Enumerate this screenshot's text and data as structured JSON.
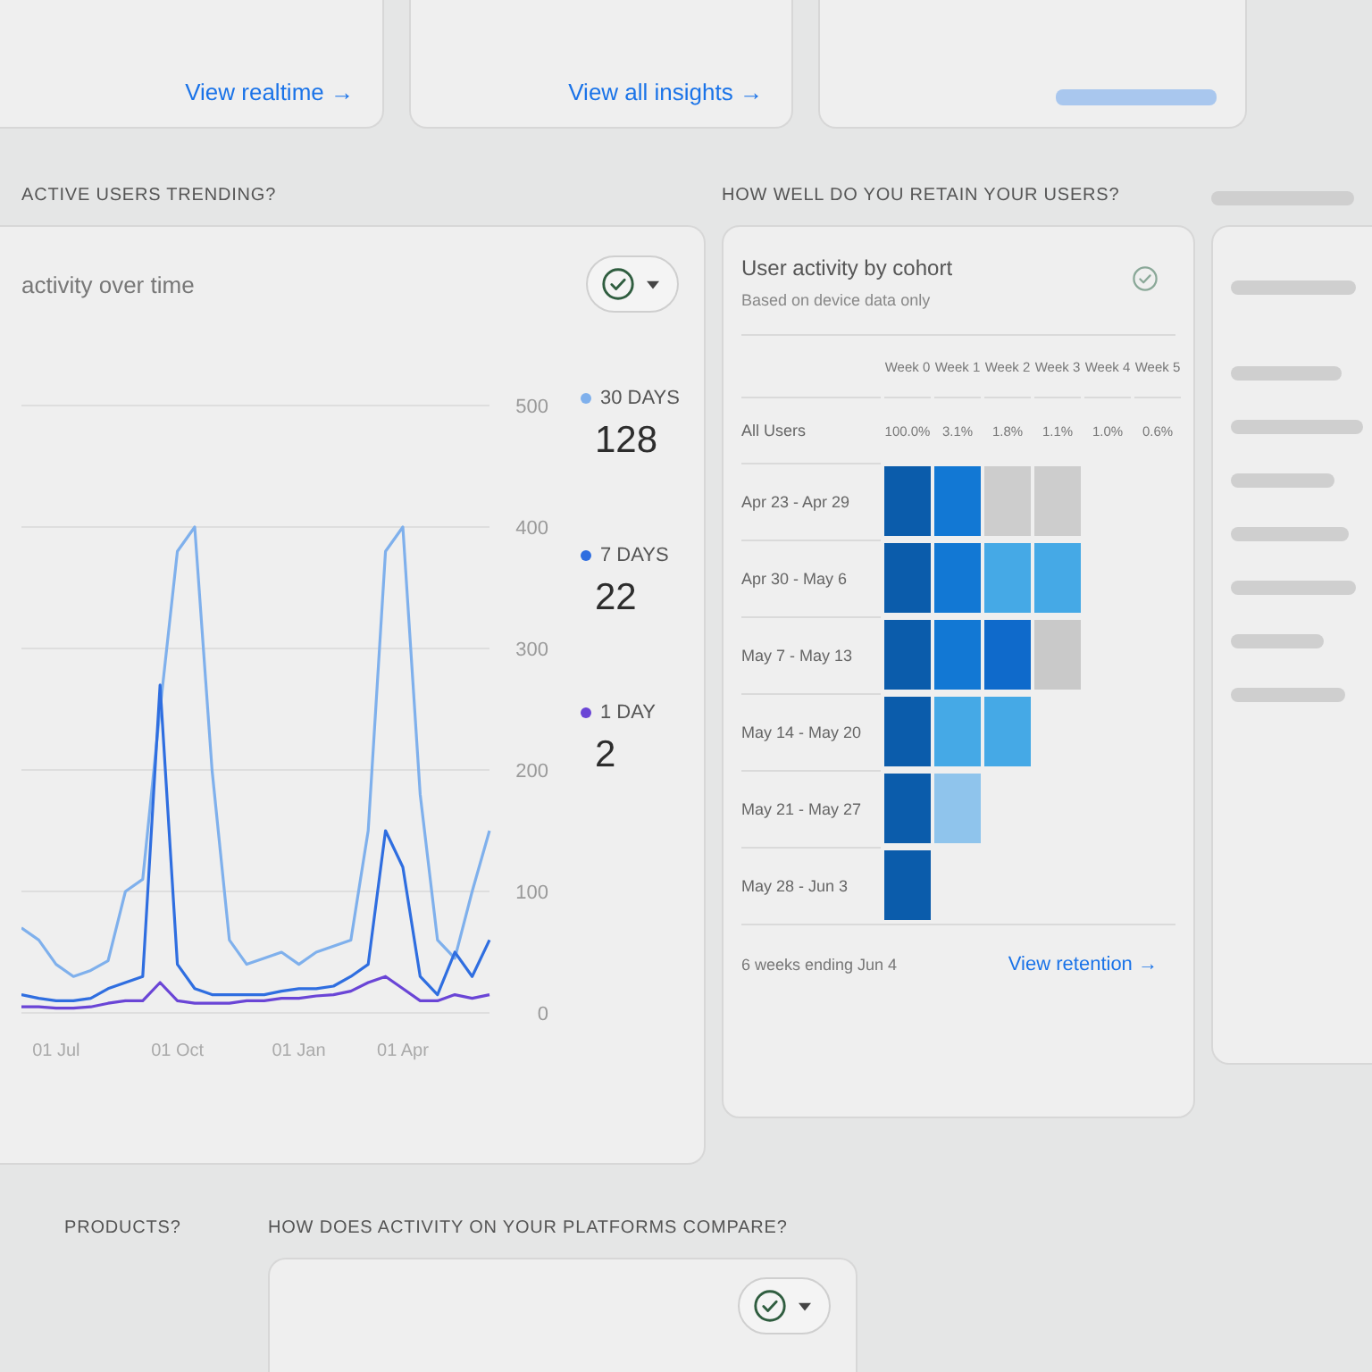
{
  "top_cards": [
    {
      "kind": "link",
      "link": "View realtime →"
    },
    {
      "kind": "link",
      "link": "View all insights →"
    },
    {
      "kind": "illegible"
    }
  ],
  "activity": {
    "heading": "ACTIVE USERS TRENDING?",
    "title": "activity over time",
    "filter": {
      "checked": true
    },
    "chart_data": {
      "type": "line",
      "grid": true,
      "categories": [
        null,
        null,
        "01 Jul",
        null,
        null,
        null,
        null,
        null,
        null,
        "01 Oct",
        null,
        null,
        null,
        null,
        null,
        null,
        "01 Jan",
        null,
        null,
        null,
        null,
        null,
        "01 Apr",
        null,
        null,
        null,
        null,
        null
      ],
      "ylim": [
        0,
        500
      ],
      "yticks": [
        0,
        100,
        200,
        300,
        400,
        500
      ],
      "series": [
        {
          "name": "30 DAYS",
          "color": "#7fb0ec",
          "values": [
            70,
            60,
            40,
            30,
            35,
            43,
            100,
            110,
            250,
            380,
            400,
            200,
            60,
            40,
            45,
            50,
            40,
            50,
            55,
            60,
            150,
            380,
            400,
            180,
            60,
            45,
            100,
            150
          ]
        },
        {
          "name": "7 DAYS",
          "color": "#2f6ee0",
          "values": [
            15,
            12,
            10,
            10,
            12,
            20,
            25,
            30,
            270,
            40,
            20,
            15,
            15,
            15,
            15,
            18,
            20,
            20,
            22,
            30,
            40,
            150,
            120,
            30,
            15,
            50,
            30,
            60
          ]
        },
        {
          "name": "1 DAY",
          "color": "#6a45d6",
          "values": [
            5,
            5,
            4,
            4,
            5,
            8,
            10,
            10,
            25,
            10,
            8,
            8,
            8,
            10,
            10,
            12,
            12,
            14,
            15,
            18,
            25,
            30,
            20,
            10,
            10,
            15,
            12,
            15
          ]
        }
      ]
    },
    "legend": [
      {
        "value": "128"
      },
      {
        "value": "22"
      },
      {
        "value": "2"
      }
    ]
  },
  "retention": {
    "heading": "HOW WELL DO YOU RETAIN YOUR USERS?",
    "title": "User activity by cohort",
    "subtitle": "Based on device data only",
    "columns": [
      "Week 0",
      "Week 1",
      "Week 2",
      "Week 3",
      "Week 4",
      "Week 5"
    ],
    "all_users": {
      "label": "All Users",
      "values": [
        "100.0%",
        "3.1%",
        "1.8%",
        "1.1%",
        "1.0%",
        "0.6%"
      ]
    },
    "rows": [
      {
        "label": "Apr 23 - Apr 29",
        "cells": [
          {
            "color": "#0b5cab"
          },
          {
            "color": "#1278d4"
          },
          {
            "color": "#cdcdcd"
          },
          {
            "color": "#cdcdcd"
          }
        ]
      },
      {
        "label": "Apr 30 - May 6",
        "cells": [
          {
            "color": "#0b5cab"
          },
          {
            "color": "#1278d4"
          },
          {
            "color": "#45a9e6"
          },
          {
            "color": "#45a9e6"
          }
        ]
      },
      {
        "label": "May 7 - May 13",
        "cells": [
          {
            "color": "#0b5cab"
          },
          {
            "color": "#1278d4"
          },
          {
            "color": "#0f6acb"
          },
          {
            "color": "#c9c9c9"
          }
        ]
      },
      {
        "label": "May 14 - May 20",
        "cells": [
          {
            "color": "#0b5cab"
          },
          {
            "color": "#45a9e6"
          },
          {
            "color": "#45a9e6"
          }
        ]
      },
      {
        "label": "May 21 - May 27",
        "cells": [
          {
            "color": "#0b5cab"
          },
          {
            "color": "#8fc4ec"
          }
        ]
      },
      {
        "label": "May 28 - Jun 3",
        "cells": [
          {
            "color": "#0b5cab"
          }
        ]
      }
    ],
    "footnote": "6 weeks ending Jun 4",
    "link": "View retention →"
  },
  "products": {
    "heading": "PRODUCTS?"
  },
  "platforms": {
    "heading": "HOW DOES ACTIVITY ON YOUR PLATFORMS COMPARE?",
    "filter": {
      "checked": true
    }
  }
}
